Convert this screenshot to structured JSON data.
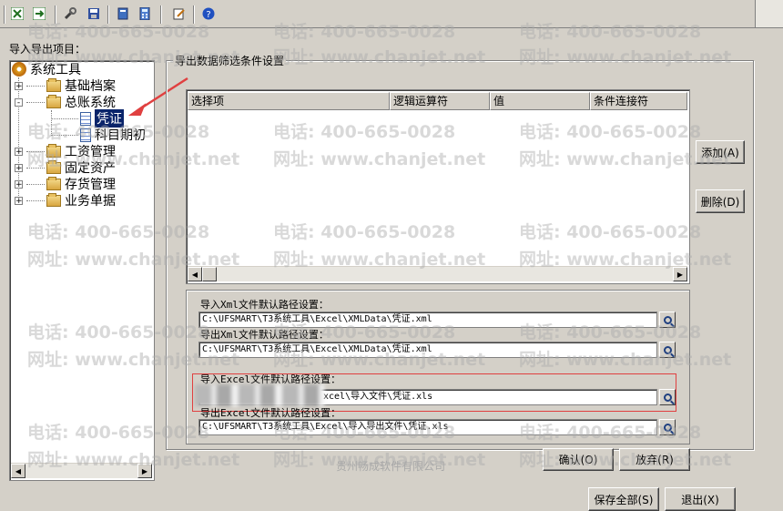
{
  "toolbar": {
    "icons": [
      "excel-import-icon",
      "excel-export-icon",
      "tools-icon",
      "save-icon",
      "book-icon",
      "calculator-icon",
      "edit-icon",
      "help-icon"
    ]
  },
  "left_panel": {
    "label": "导入导出项目：",
    "tree": {
      "root": "系统工具",
      "items": [
        {
          "label": "基础档案",
          "expander": "+"
        },
        {
          "label": "总账系统",
          "expander": "-",
          "children": [
            "凭证",
            "科目期初"
          ]
        },
        {
          "label": "工资管理",
          "expander": "+"
        },
        {
          "label": "固定资产",
          "expander": "+"
        },
        {
          "label": "存货管理",
          "expander": "+"
        },
        {
          "label": "业务单据",
          "expander": "+"
        }
      ],
      "selected": "凭证"
    }
  },
  "filter": {
    "title": "导出数据筛选条件设置",
    "columns": [
      "选择项",
      "逻辑运算符",
      "值",
      "条件连接符"
    ],
    "add_button": "添加(A)",
    "delete_button": "删除(D)"
  },
  "paths": {
    "import_xml_label": "导入Xml文件默认路径设置：",
    "import_xml_value": "C:\\UFSMART\\T3系统工具\\Excel\\XMLData\\凭证.xml",
    "export_xml_label": "导出Xml文件默认路径设置：",
    "export_xml_value": "C:\\UFSMART\\T3系统工具\\Excel\\XMLData\\凭证.xml",
    "import_excel_label": "导入Excel文件默认路径设置：",
    "import_excel_value": "xcel\\导入文件\\凭证.xls",
    "export_excel_label": "导出Excel文件默认路径设置：",
    "export_excel_value": "C:\\UFSMART\\T3系统工具\\Excel\\导入导出文件\\凭证.xls"
  },
  "buttons": {
    "confirm": "确认(O)",
    "cancel": "放弃(R)",
    "save_all": "保存全部(S)",
    "exit": "退出(X)"
  },
  "watermark": {
    "phone": "电话: 400-665-0028",
    "site": "网址: www.chanjet.net",
    "company": "贵州畅成软件有限公司"
  },
  "colors": {
    "selection": "#0a246a",
    "annotation": "#e04040",
    "face": "#d4d0c8"
  }
}
